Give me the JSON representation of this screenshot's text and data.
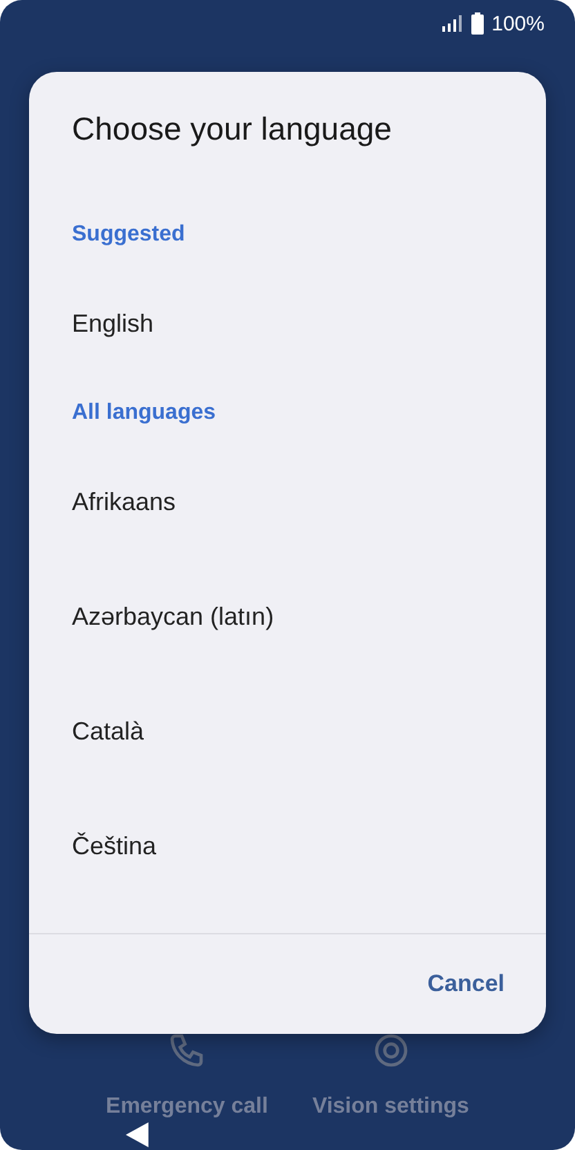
{
  "status_bar": {
    "battery": "100%"
  },
  "dialog": {
    "title": "Choose your language",
    "sections": [
      {
        "heading": "Suggested",
        "languages": [
          "English"
        ]
      },
      {
        "heading": "All languages",
        "languages": [
          "Afrikaans",
          "Azərbaycan (latın)",
          "Català",
          "Čeština"
        ]
      }
    ],
    "buttons": [
      "Cancel"
    ]
  },
  "background_actions": [
    {
      "kind": "phone",
      "label": "Emergency call"
    },
    {
      "kind": "eye",
      "label": "Vision settings"
    }
  ]
}
